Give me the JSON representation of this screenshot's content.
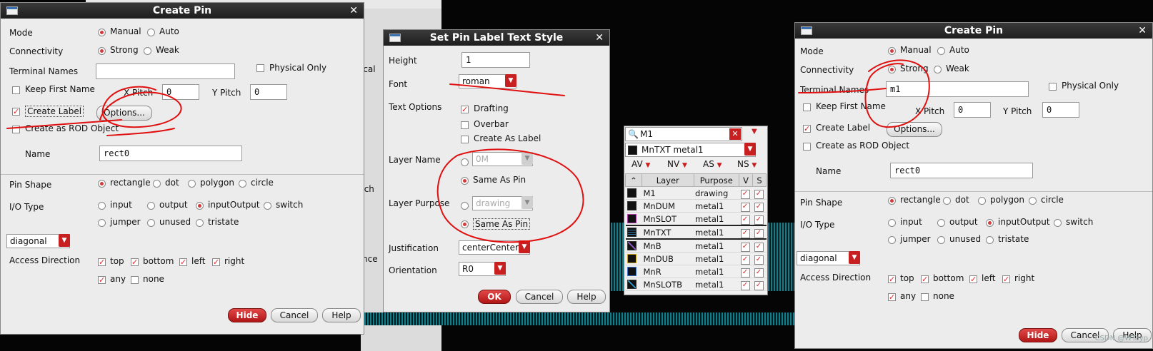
{
  "dialog1": {
    "title": "Create Pin",
    "mode_label": "Mode",
    "mode_manual": "Manual",
    "mode_auto": "Auto",
    "connectivity_label": "Connectivity",
    "conn_strong": "Strong",
    "conn_weak": "Weak",
    "terminal_names_label": "Terminal Names",
    "terminal_names_value": "",
    "physical_only": "Physical Only",
    "keep_first_name": "Keep First Name",
    "x_pitch_label": "X Pitch",
    "x_pitch_value": "0",
    "y_pitch_label": "Y Pitch",
    "y_pitch_value": "0",
    "create_label": "Create Label",
    "options_button": "Options...",
    "create_rod": "Create as ROD Object",
    "name_label": "Name",
    "name_value": "rect0",
    "pin_shape_label": "Pin Shape",
    "shape_rectangle": "rectangle",
    "shape_dot": "dot",
    "shape_polygon": "polygon",
    "shape_circle": "circle",
    "io_type_label": "I/O Type",
    "io_input": "input",
    "io_output": "output",
    "io_inputoutput": "inputOutput",
    "io_switch": "switch",
    "io_jumper": "jumper",
    "io_unused": "unused",
    "io_tristate": "tristate",
    "diagonal_select": "diagonal",
    "access_direction_label": "Access Direction",
    "dir_top": "top",
    "dir_bottom": "bottom",
    "dir_left": "left",
    "dir_right": "right",
    "dir_any": "any",
    "dir_none": "none",
    "hide_button": "Hide",
    "cancel_button": "Cancel",
    "help_button": "Help"
  },
  "dialog2": {
    "title": "Set Pin Label Text Style",
    "height_label": "Height",
    "height_value": "1",
    "font_label": "Font",
    "font_value": "roman",
    "text_options_label": "Text Options",
    "drafting": "Drafting",
    "overbar": "Overbar",
    "create_as_label": "Create As Label",
    "layer_name_label": "Layer Name",
    "layer_name_value": "0M",
    "same_as_pin_1": "Same As Pin",
    "layer_purpose_label": "Layer Purpose",
    "layer_purpose_value": "drawing",
    "same_as_pin_2": "Same As Pin",
    "justification_label": "Justification",
    "justification_value": "centerCenter",
    "orientation_label": "Orientation",
    "orientation_value": "R0",
    "ok_button": "OK",
    "cancel_button": "Cancel",
    "help_button": "Help"
  },
  "layer_panel": {
    "search_value": "M1",
    "current_layer": "MnTXT metal1",
    "filters": [
      "AV",
      "NV",
      "AS",
      "NS"
    ],
    "columns": [
      "Layer",
      "Purpose",
      "V",
      "S"
    ],
    "rows": [
      {
        "layer": "M1",
        "purpose": "drawing"
      },
      {
        "layer": "MnDUM",
        "purpose": "metal1"
      },
      {
        "layer": "MnSLOT",
        "purpose": "metal1"
      },
      {
        "layer": "MnTXT",
        "purpose": "metal1"
      },
      {
        "layer": "MnB",
        "purpose": "metal1"
      },
      {
        "layer": "MnDUB",
        "purpose": "metal1"
      },
      {
        "layer": "MnR",
        "purpose": "metal1"
      },
      {
        "layer": "MnSLOTB",
        "purpose": "metal1"
      }
    ]
  },
  "dialog3": {
    "title": "Create Pin",
    "mode_label": "Mode",
    "mode_manual": "Manual",
    "mode_auto": "Auto",
    "connectivity_label": "Connectivity",
    "conn_strong": "Strong",
    "conn_weak": "Weak",
    "terminal_names_label": "Terminal Names",
    "terminal_names_value": "m1",
    "physical_only": "Physical Only",
    "keep_first_name": "Keep First Name",
    "x_pitch_label": "X Pitch",
    "x_pitch_value": "0",
    "y_pitch_label": "Y Pitch",
    "y_pitch_value": "0",
    "create_label": "Create Label",
    "options_button": "Options...",
    "create_rod": "Create as ROD Object",
    "name_label": "Name",
    "name_value": "rect0",
    "pin_shape_label": "Pin Shape",
    "shape_rectangle": "rectangle",
    "shape_dot": "dot",
    "shape_polygon": "polygon",
    "shape_circle": "circle",
    "io_type_label": "I/O Type",
    "io_input": "input",
    "io_output": "output",
    "io_inputoutput": "inputOutput",
    "io_switch": "switch",
    "io_jumper": "jumper",
    "io_unused": "unused",
    "io_tristate": "tristate",
    "diagonal_select": "diagonal",
    "access_direction_label": "Access Direction",
    "dir_top": "top",
    "dir_bottom": "bottom",
    "dir_left": "left",
    "dir_right": "right",
    "dir_any": "any",
    "dir_none": "none",
    "hide_button": "Hide",
    "cancel_button": "Cancel",
    "help_button": "Help"
  },
  "background_fragments": {
    "frag1": "ical",
    "frag2": "tch",
    "frag3": "nce"
  },
  "watermark": "CSDN @WTayp",
  "colors": {
    "accent_red": "#c82020",
    "annotation_red": "#e01010",
    "titlebar": "#2a2a2a"
  }
}
